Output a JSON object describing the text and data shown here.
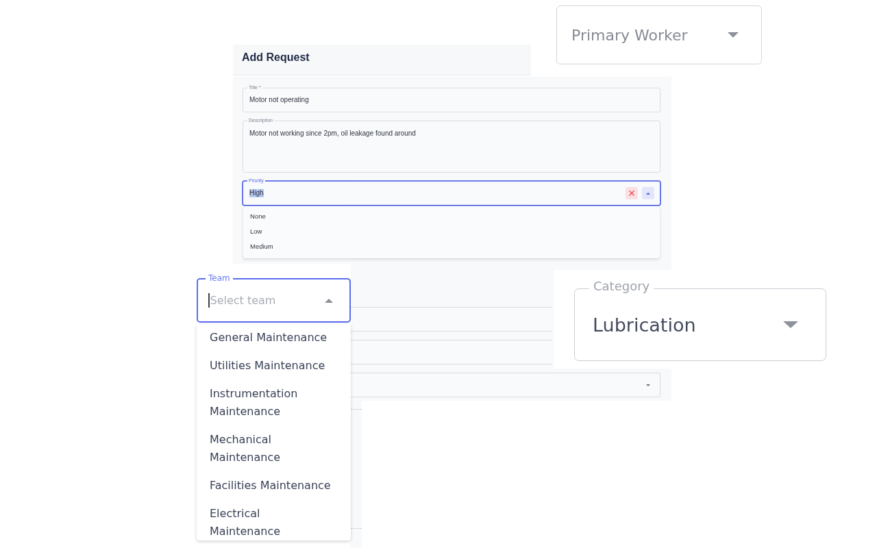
{
  "primary_worker_select": {
    "label": "Primary Worker"
  },
  "add_request": {
    "title": "Add Request",
    "fields": [
      {
        "kind": "text",
        "label": "Title *",
        "value": "Motor not operating",
        "focused": false,
        "text_selected": false
      },
      {
        "kind": "textarea",
        "label": "Description",
        "value": "Motor not working since 2pm, oil leakage found around",
        "focused": false,
        "text_selected": false
      },
      {
        "kind": "select",
        "label": "Priority",
        "value": "High",
        "focused": true,
        "text_selected": true,
        "clearable": true,
        "expanded": true,
        "options": [
          {
            "label": "None",
            "selected": false
          },
          {
            "label": "Low",
            "selected": false
          },
          {
            "label": "Medium",
            "selected": false
          }
        ]
      },
      {
        "kind": "text",
        "focused": false
      },
      {
        "kind": "text",
        "focused": false
      },
      {
        "kind": "select",
        "focused": false,
        "clearable": false,
        "expanded": false
      }
    ]
  },
  "team_select": {
    "label": "Team",
    "placeholder": "Select team",
    "focused": true,
    "expanded": true,
    "options": [
      {
        "label": "General Maintenance",
        "selected": false
      },
      {
        "label": "Utilities Maintenance",
        "selected": false
      },
      {
        "label": "Instrumentation Maintenance",
        "selected": false
      },
      {
        "label": "Mechanical Maintenance",
        "selected": false
      },
      {
        "label": "Facilities Maintenance",
        "selected": false
      },
      {
        "label": "Electrical Maintenance",
        "selected": false
      }
    ]
  },
  "category_select": {
    "label": "Category",
    "value": "Lubrication"
  }
}
